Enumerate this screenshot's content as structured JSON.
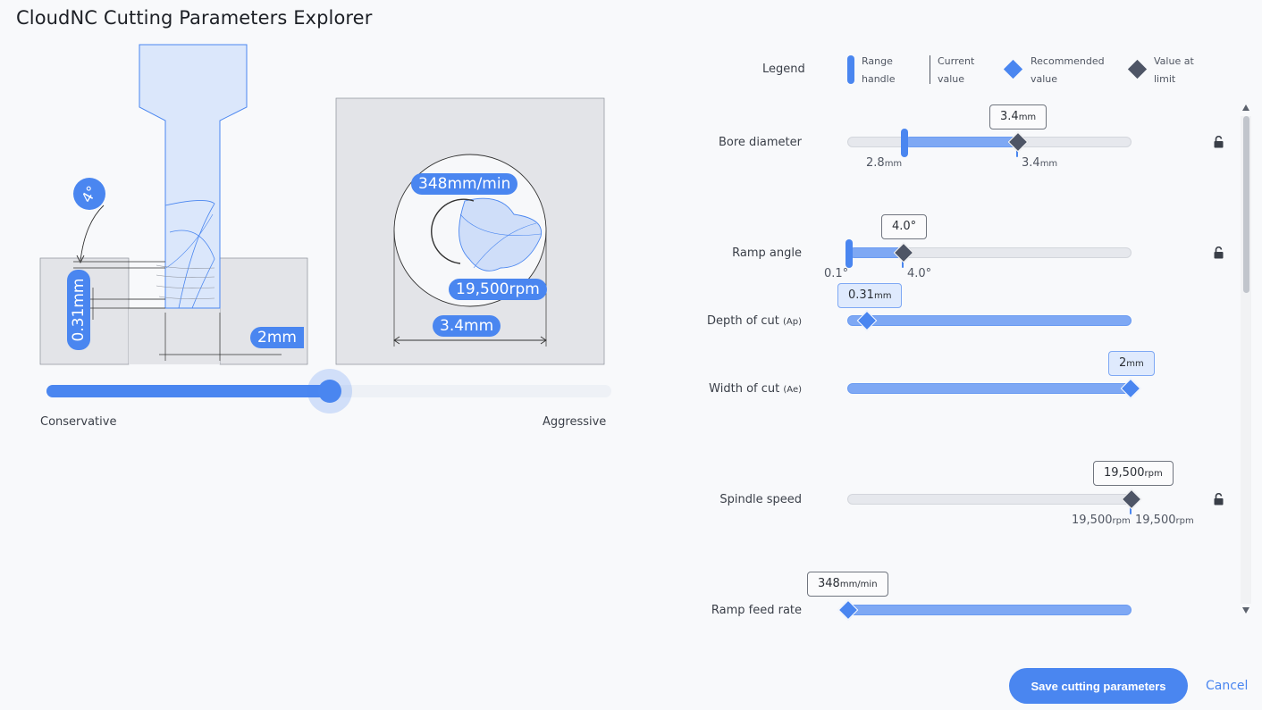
{
  "app": {
    "title": "CloudNC Cutting Parameters Explorer"
  },
  "illustration": {
    "angle_badge": "4°",
    "depth_label": "0.31mm",
    "width_label": "2mm",
    "feed_label": "348mm/min",
    "rpm_label": "19,500rpm",
    "diameter_label": "3.4mm"
  },
  "aggressiveness": {
    "value_fraction": 0.5,
    "left_label": "Conservative",
    "right_label": "Aggressive"
  },
  "legend": {
    "title": "Legend",
    "range_handle": [
      "Range",
      "handle"
    ],
    "current_value": [
      "Current",
      "value"
    ],
    "recommended_value": [
      "Recommended",
      "value"
    ],
    "value_at_limit": [
      "Value at",
      "limit"
    ]
  },
  "params": {
    "bore_diameter": {
      "label": "Bore diameter",
      "bubble_num": "3.4",
      "bubble_unit": "mm",
      "min_num": "2.8",
      "min_unit": "mm",
      "cur_num": "3.4",
      "cur_unit": "mm"
    },
    "ramp_angle": {
      "label": "Ramp angle",
      "bubble": "4.0°",
      "min": "0.1°",
      "cur": "4.0°"
    },
    "depth_of_cut": {
      "label": "Depth of cut",
      "abbr": "(Ap)",
      "bubble_num": "0.31",
      "bubble_unit": "mm"
    },
    "width_of_cut": {
      "label": "Width of cut",
      "abbr": "(Ae)",
      "bubble_num": "2",
      "bubble_unit": "mm"
    },
    "spindle_speed": {
      "label": "Spindle speed",
      "bubble_num": "19,500",
      "bubble_unit": "rpm",
      "min_num": "19,500",
      "min_unit": "rpm",
      "cur_num": "19,500",
      "cur_unit": "rpm"
    },
    "ramp_feed_rate": {
      "label": "Ramp feed rate",
      "bubble_num": "348",
      "bubble_unit": "mm/min"
    }
  },
  "actions": {
    "save": "Save cutting parameters",
    "cancel": "Cancel"
  },
  "colors": {
    "accent": "#4a86f0",
    "limit": "#4e5566",
    "fill": "#7ea8f4"
  },
  "icons": {
    "lock": "unlocked-padlock-icon"
  }
}
